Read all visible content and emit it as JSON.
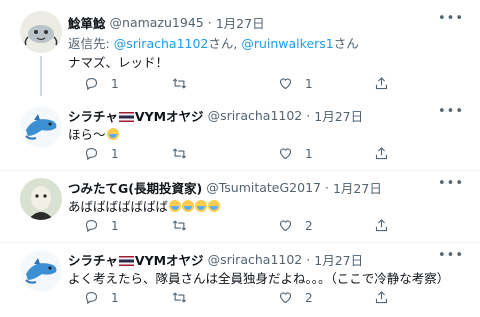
{
  "tweets": [
    {
      "name": "鯰箪鯰",
      "handle": "@namazu1945",
      "dot": "·",
      "date": "1月27日",
      "reply_prefix": "返信先: ",
      "reply_to_1": "@sriracha1102",
      "reply_sep": "さん, ",
      "reply_to_2": "@ruinwalkers1",
      "reply_suffix": "さん",
      "text": "ナマズ、レッド！",
      "replies": "1",
      "retweets": "",
      "likes": "1",
      "avatar_icon": "catfish-drawing-icon"
    },
    {
      "name": "シラチャ",
      "name_suffix": "VYMオヤジ",
      "handle": "@sriracha1102",
      "dot": "·",
      "date": "1月27日",
      "text": "ほら〜",
      "replies": "1",
      "retweets": "",
      "likes": "1",
      "avatar_icon": "dolphin-avatar-icon"
    },
    {
      "name": "つみたてG(長期投資家)",
      "handle": "@TsumitateG2017",
      "dot": "·",
      "date": "1月27日",
      "text": "あばばばばばばば",
      "replies": "1",
      "retweets": "",
      "likes": "2",
      "avatar_icon": "character-avatar-icon"
    },
    {
      "name": "シラチャ",
      "name_suffix": "VYMオヤジ",
      "handle": "@sriracha1102",
      "dot": "·",
      "date": "1月27日",
      "text": "よく考えたら、隊員さんは全員独身だよね。。。（ここで冷静な考察）",
      "replies": "1",
      "retweets": "",
      "likes": "2",
      "avatar_icon": "dolphin-avatar-icon"
    }
  ],
  "colors": {
    "link": "#1d9bf0",
    "muted": "#536471",
    "text": "#0f1419",
    "thread_line": "#cfd9de"
  }
}
